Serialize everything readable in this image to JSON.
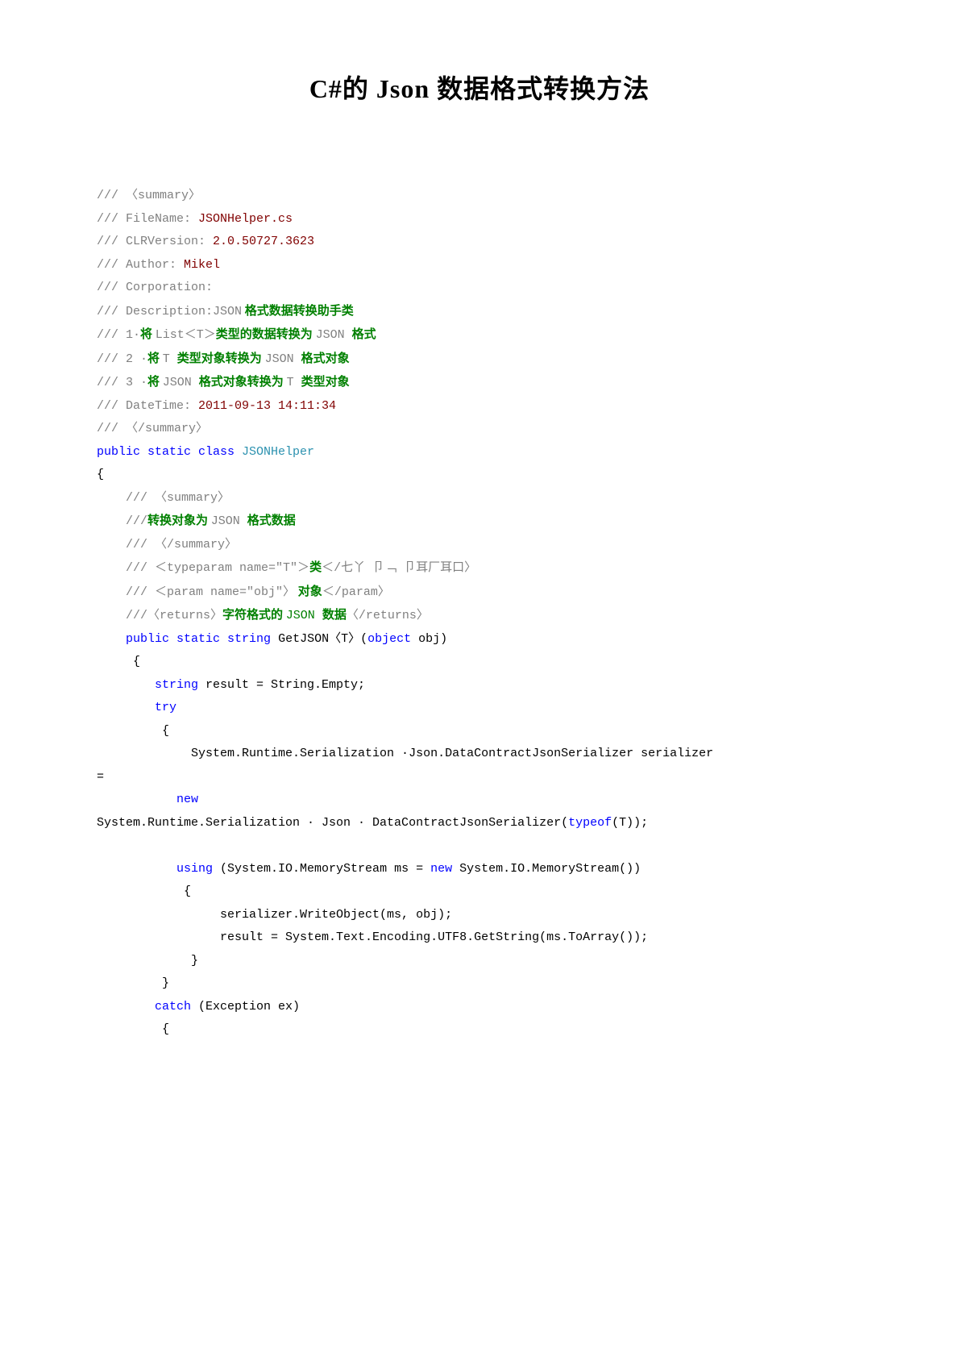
{
  "title": "C#的 Json 数据格式转换方法",
  "code": {
    "l1": "/// 〈summary〉",
    "l2_pre": "/// FileName: ",
    "l2_val": "JSONHelper.cs",
    "l3_pre": "/// CLRVersion: ",
    "l3_val": "2.0.50727.3623",
    "l4_pre": "/// Author: ",
    "l4_val": "Mikel",
    "l5": "/// Corporation:",
    "l6_pre": "/// Description:JSON",
    "l6_cn": " 格式数据转换助手类",
    "l7_pre": "/// 1·",
    "l7_cn1": "将 ",
    "l7_mid": "List＜T＞",
    "l7_cn2": "类型的数据转换为 ",
    "l7_json": "JSON ",
    "l7_cn3": "格式",
    "l8_pre": "/// 2 ·",
    "l8_cn1": "将 ",
    "l8_t": "T ",
    "l8_cn2": "类型对象转换为 ",
    "l8_json": "JSON ",
    "l8_cn3": "格式对象",
    "l9_pre": "/// 3 ·",
    "l9_cn1": "将 ",
    "l9_json": "JSON ",
    "l9_cn2": "格式对象转换为 ",
    "l9_t": "T ",
    "l9_cn3": "类型对象",
    "l10_pre": "/// DateTime: ",
    "l10_val": "2011-09-13 14:11:34",
    "l11": "/// 〈/summary〉",
    "l12_pub": "public ",
    "l12_static": "static ",
    "l12_class": "class ",
    "l12_name": "JSONHelper",
    "l13": "{",
    "l14": "    /// 〈summary〉",
    "l15_pre": "    ///",
    "l15_cn1": "转换对象为 ",
    "l15_json": "JSON ",
    "l15_cn2": "格式数据",
    "l16": "    /// 〈/summary〉",
    "l17_pre": "    /// ＜",
    "l17_tp": "typeparam name",
    "l17_eq": "=\"T\"＞",
    "l17_cn": "类",
    "l17_suf": "＜/七丫 卩﹁ 卩耳厂耳口〉",
    "l18_pre": "    /// ＜",
    "l18_param": "param name",
    "l18_eq": "=\"obj\"〉",
    "l18_cn": " 对象",
    "l18_suf": "＜/param〉",
    "l19_pre": "    ///〈returns〉",
    "l19_cn1": "字符格式的 ",
    "l19_json": "JSON ",
    "l19_cn2": "数据",
    "l19_suf": "〈/returns〉",
    "l20_pub": "    public ",
    "l20_static": "static ",
    "l20_string": "string ",
    "l20_name": "GetJSON〈T〉(",
    "l20_obj": "object ",
    "l20_param": "obj)",
    "l21": "     {",
    "l22_str": "        string ",
    "l22_rest": "result = String.Empty;",
    "l23": "        try",
    "l24": "         {",
    "l25": "             System.Runtime.Serialization ·Json.DataContractJsonSerializer serializer",
    "l26": "=",
    "l27": "           new",
    "l28_a": "System.Runtime.Serialization · Json · DataContractJsonSerializer(",
    "l28_typeof": "typeof",
    "l28_b": "(T));",
    "l30_using": "           using ",
    "l30_a": "(System.IO.MemoryStream ms = ",
    "l30_new": "new ",
    "l30_b": "System.IO.MemoryStream())",
    "l31": "            {",
    "l32": "                 serializer.WriteObject(ms, obj);",
    "l33": "                 result = System.Text.Encoding.UTF8.GetString(ms.ToArray());",
    "l34": "             }",
    "l35": "         }",
    "l36_catch": "        catch ",
    "l36_rest": "(Exception ex)",
    "l37": "         {"
  }
}
